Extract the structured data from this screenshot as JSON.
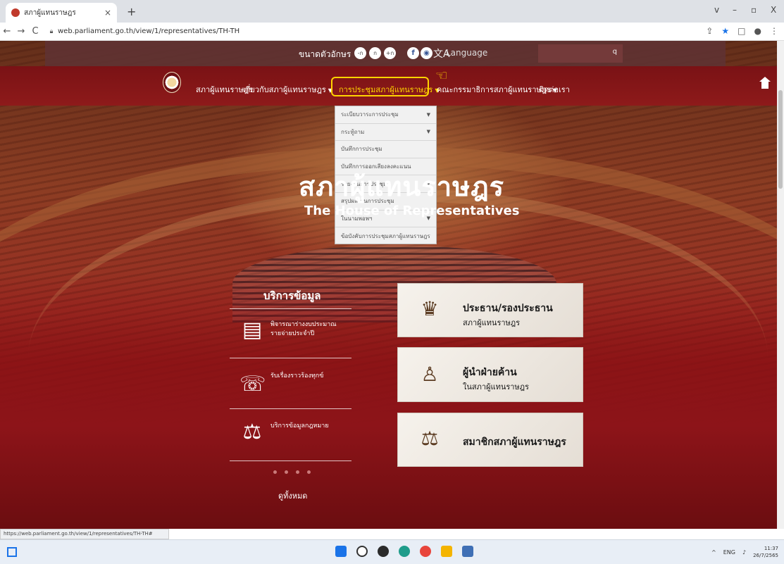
{
  "browser": {
    "tab_title": "สภาผู้แทนราษฎร",
    "tab_close": "×",
    "new_tab": "+",
    "url": "web.parliament.go.th/view/1/representatives/TH-TH",
    "window_controls": [
      "v",
      "–",
      "▫",
      "X"
    ]
  },
  "utility_bar": {
    "font_size_label": "ขนาดตัวอักษร",
    "font_buttons": [
      "-ก",
      "ก",
      "+ก"
    ],
    "social": [
      "f",
      "◉"
    ],
    "language_icon": "文A",
    "language_label": "Language",
    "search_icon": "q"
  },
  "nav": {
    "items": [
      {
        "label": "สภาผู้แทนราษฎร",
        "caret": ""
      },
      {
        "label": "เกี่ยวกับสภาผู้แทนราษฎร",
        "caret": "▼"
      },
      {
        "label": "การประชุมสภาผู้แทนราษฎร",
        "caret": "▼"
      },
      {
        "label": "คณะกรรมาธิการสภาผู้แทนราษฎร",
        "caret": "▼"
      },
      {
        "label": "ติดต่อเรา",
        "caret": ""
      }
    ],
    "active_index": 2
  },
  "dropdown": {
    "items": [
      {
        "label": "ระเบียบวาระการประชุม",
        "caret": "▼"
      },
      {
        "label": "กระทู้ถาม",
        "caret": "▼"
      },
      {
        "label": "บันทึกการประชุม",
        "caret": ""
      },
      {
        "label": "บันทึกการออกเสียงลงคะแนน",
        "caret": ""
      },
      {
        "label": "รายงานการประชุม",
        "caret": "▼"
      },
      {
        "label": "สรุปผลงานการประชุม",
        "caret": ""
      },
      {
        "label": "ในนามพอพฯ",
        "caret": "▼"
      },
      {
        "label": "ข้อบังคับการประชุมสภาผู้แทนราษฎร",
        "caret": ""
      }
    ]
  },
  "hero": {
    "title": "สภาผู้แทนราษฎร",
    "subtitle": "The House of Representatives"
  },
  "services": {
    "title": "บริการข้อมูล",
    "items": [
      {
        "label_line1": "พิจารณาร่างงบประมาณ",
        "label_line2": "รายจ่ายประจำปี",
        "icon": "budget-document-icon"
      },
      {
        "label_line1": "รับเรื่องราวร้องทุกข์",
        "label_line2": "",
        "icon": "handshake-icon"
      },
      {
        "label_line1": "บริการข้อมูลกฎหมาย",
        "label_line2": "",
        "icon": "law-scales-icon"
      }
    ],
    "see_all": "ดูทั้งหมด"
  },
  "cards": [
    {
      "title": "ประธาน/รองประธาน",
      "subtitle": "สภาผู้แทนราษฎร",
      "icon": "speaker-podium-icon"
    },
    {
      "title": "ผู้นำฝ่ายค้าน",
      "subtitle": "ในสภาผู้แทนราษฎร",
      "icon": "opposition-leader-icon"
    },
    {
      "title": "สมาชิกสภาผู้แทนราษฎร",
      "subtitle": "",
      "icon": "scales-icon"
    }
  ],
  "status_url": "https://web.parliament.go.th/view/1/representatives/TH-TH#",
  "taskbar": {
    "lang": "ENG",
    "time": "11:37",
    "date": "26/7/2565"
  }
}
